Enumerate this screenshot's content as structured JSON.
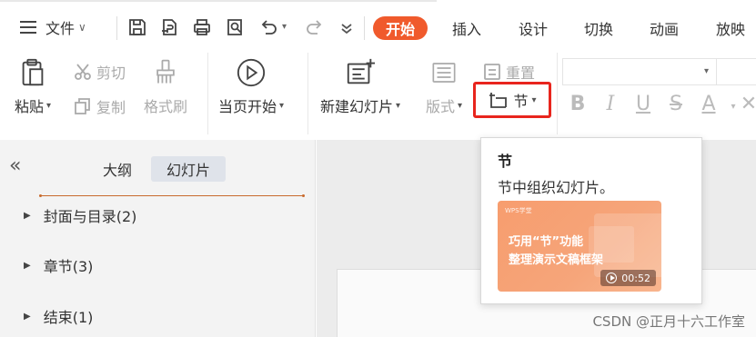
{
  "topbar": {
    "file_menu_label": "文件",
    "tabs": [
      {
        "label": "开始",
        "active": true
      },
      {
        "label": "插入"
      },
      {
        "label": "设计"
      },
      {
        "label": "切换"
      },
      {
        "label": "动画"
      },
      {
        "label": "放映"
      }
    ],
    "quick_icons": [
      "save-icon",
      "export-icon",
      "print-icon",
      "print-preview-icon",
      "undo-icon",
      "redo-icon",
      "customize-icon"
    ]
  },
  "ribbon": {
    "paste_label": "粘贴",
    "cut_label": "剪切",
    "copy_label": "复制",
    "format_painter_label": "格式刷",
    "play_from_current_label": "当页开始",
    "new_slide_label": "新建幻灯片",
    "layout_label": "版式",
    "reset_label": "重置",
    "section_label": "节",
    "format_buttons": [
      "B",
      "I",
      "U",
      "S",
      "A"
    ]
  },
  "left_pane": {
    "tabs": [
      {
        "label": "大纲"
      },
      {
        "label": "幻灯片",
        "active": true
      }
    ],
    "outline_items": [
      {
        "label": "封面与目录(2)"
      },
      {
        "label": "章节(3)"
      },
      {
        "label": "结束(1)"
      }
    ]
  },
  "tooltip": {
    "title": "节",
    "description": "节中组织幻灯片。",
    "promo_brand": "WPS学堂",
    "promo_line1": "巧用“节”功能",
    "promo_line2": "整理演示文稿框架",
    "promo_duration": "00:52"
  },
  "watermark": "CSDN @正月十六工作室",
  "colors": {
    "accent": "#f05a2c",
    "highlight_border": "#e8251d",
    "pane_bg": "#f3f3f3"
  }
}
